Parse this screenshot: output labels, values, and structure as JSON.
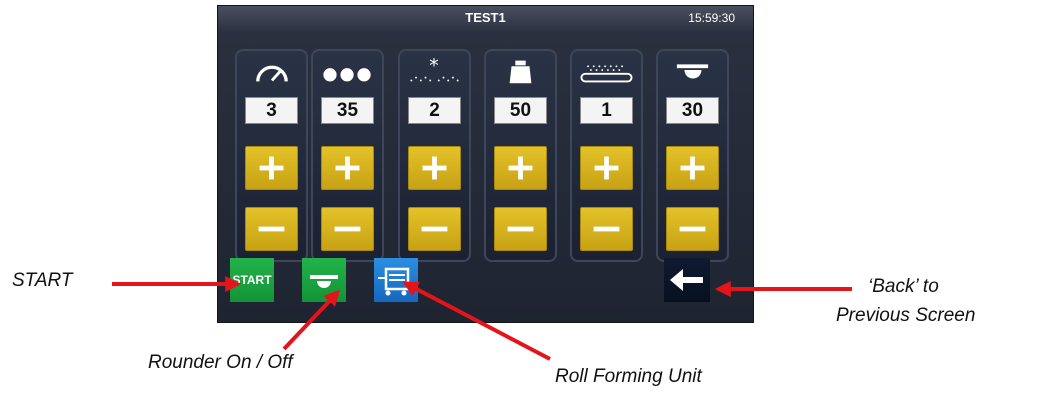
{
  "screen": {
    "title": "TEST1",
    "time": "15:59:30",
    "columns": [
      {
        "icon": "speed-gauge-icon",
        "value": "3"
      },
      {
        "icon": "three-balls-icon",
        "value": "35"
      },
      {
        "icon": "flour-duster-icon",
        "value": "2"
      },
      {
        "icon": "weight-icon",
        "value": "50"
      },
      {
        "icon": "conveyor-belt-icon",
        "value": "1"
      },
      {
        "icon": "rounder-icon",
        "value": "30"
      }
    ],
    "plus_icon": "plus-icon",
    "minus_icon": "minus-icon",
    "start_label": "START",
    "back_icon": "arrow-left-icon"
  },
  "annotations": {
    "start": "START",
    "rounder": "Rounder On / Off",
    "roll_forming": "Roll Forming Unit",
    "back_line1": "‘Back’ to",
    "back_line2": "Previous Screen"
  },
  "colors": {
    "button_yellow": "#d9b51f",
    "start_green": "#1ea443",
    "roll_blue": "#1e7fd4",
    "back_navy": "#0a1428",
    "arrow_red": "#e3151a"
  }
}
